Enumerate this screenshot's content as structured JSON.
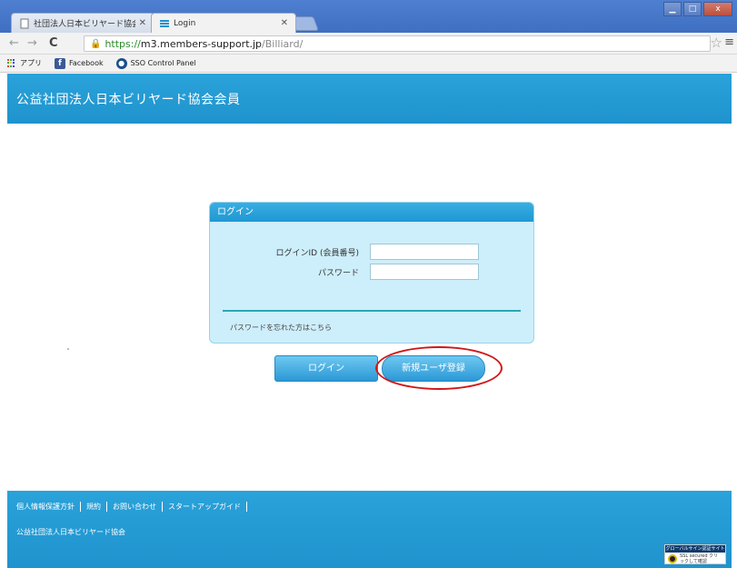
{
  "browser": {
    "tabs": [
      {
        "title": "社団法人日本ビリヤード協会",
        "active": false
      },
      {
        "title": "Login",
        "active": true
      }
    ],
    "window_buttons": [
      "▁",
      "□",
      "x"
    ],
    "url": {
      "scheme": "https://",
      "host": "m3.members-support.jp",
      "path": "/Billiard/"
    },
    "bookmarks": [
      {
        "label": "アプリ",
        "icon": "apps-icon"
      },
      {
        "label": "Facebook",
        "icon": "facebook-icon"
      },
      {
        "label": "SSO Control Panel",
        "icon": "sso-icon"
      }
    ]
  },
  "header": {
    "title": "公益社団法人日本ビリヤード協会会員"
  },
  "login": {
    "heading": "ログイン",
    "id_label": "ログインID (会員番号)",
    "password_label": "パスワード",
    "id_value": "",
    "password_value": "",
    "forgot_link": "パスワードを忘れた方はこちら"
  },
  "buttons": {
    "login": "ログイン",
    "register": "新規ユーザ登録"
  },
  "footer": {
    "links": [
      "個人情報保護方針",
      "規約",
      "お問い合わせ",
      "スタートアップガイド"
    ],
    "org": "公益社団法人日本ビリヤード協会",
    "ssl_badge": {
      "top": "グローバルサイン認証サイト",
      "bottom": "SSL secured クリックして確認"
    }
  },
  "colors": {
    "header": "#1f93cd",
    "login_box": "#cdeefb",
    "highlight": "#d01818"
  }
}
